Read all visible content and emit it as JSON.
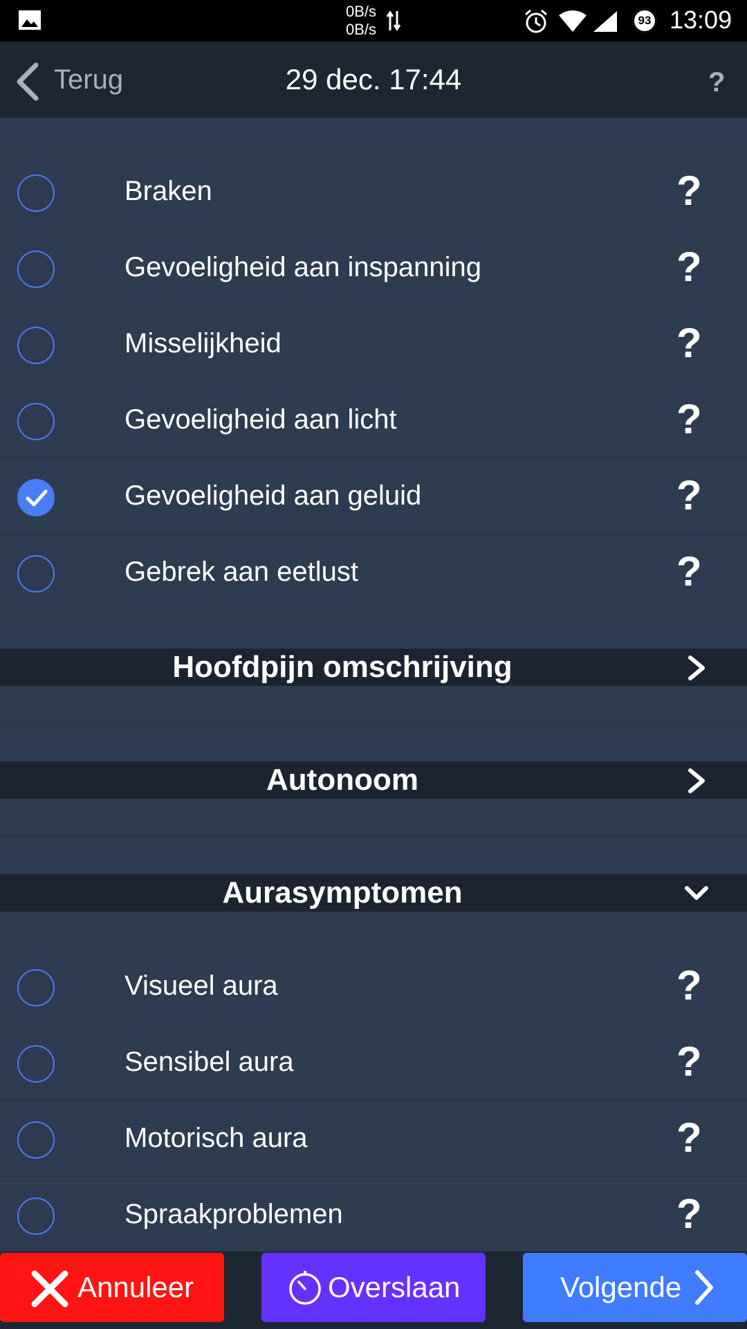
{
  "status_bar": {
    "net_up": "0B/s",
    "net_down": "0B/s",
    "battery": "93",
    "time": "13:09"
  },
  "nav": {
    "back_label": "Terug",
    "title": "29 dec. 17:44",
    "help": "?"
  },
  "symptoms": [
    {
      "label": "Braken",
      "checked": false,
      "help": "?"
    },
    {
      "label": "Gevoeligheid aan inspanning",
      "checked": false,
      "help": "?"
    },
    {
      "label": "Misselijkheid",
      "checked": false,
      "help": "?"
    },
    {
      "label": "Gevoeligheid aan licht",
      "checked": false,
      "help": "?"
    },
    {
      "label": "Gevoeligheid aan geluid",
      "checked": true,
      "help": "?"
    },
    {
      "label": "Gebrek aan eetlust",
      "checked": false,
      "help": "?"
    }
  ],
  "sections": [
    {
      "title": "Hoofdpijn omschrijving",
      "state": "collapsed",
      "icon": "chevron-right-icon"
    },
    {
      "title": "Autonoom",
      "state": "collapsed",
      "icon": "chevron-right-icon"
    },
    {
      "title": "Aurasymptomen",
      "state": "expanded",
      "icon": "chevron-down-icon"
    }
  ],
  "aura": [
    {
      "label": "Visueel aura",
      "checked": false,
      "help": "?"
    },
    {
      "label": "Sensibel aura",
      "checked": false,
      "help": "?"
    },
    {
      "label": "Motorisch aura",
      "checked": false,
      "help": "?"
    },
    {
      "label": "Spraakproblemen",
      "checked": false,
      "help": "?"
    }
  ],
  "buttons": {
    "cancel": "Annuleer",
    "skip": "Overslaan",
    "next": "Volgende"
  },
  "colors": {
    "background": "#2d3c50",
    "header": "#1b2430",
    "accent": "#4a7cf6",
    "cancel": "#ff1414",
    "skip": "#6531ff",
    "next": "#3f7bff"
  }
}
